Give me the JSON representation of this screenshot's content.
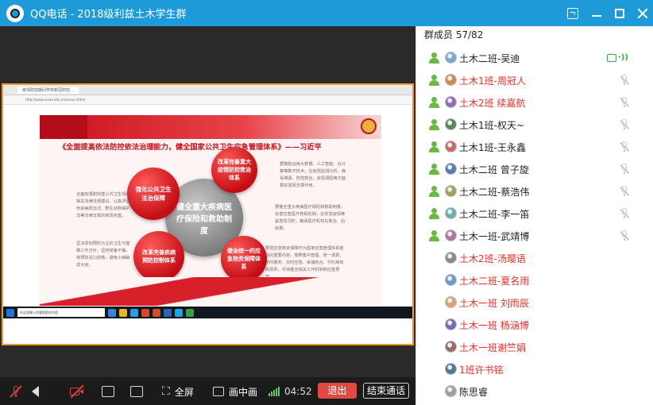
{
  "window": {
    "title": "QQ电话 - 2018级利兹土木学生群"
  },
  "shared_screen": {
    "browser_tab": "疫情防控期间学校新冠防控...",
    "address": "http://www.xxxxx.edu.cn/xxxxx.shtml",
    "slide": {
      "headline": "《全面提高依法防控依法治理能力，健全国家公共卫生应急管理体系》——习近平",
      "center_circle": "健全重大疾病医疗保险和救助制度",
      "circle_top_left": "强化公共卫生法治保障",
      "circle_top_right": "改革完善重大疫情防控救治体系",
      "circle_bottom_left": "改革完善疾病预防控制体系",
      "circle_bottom_right": "健全统一的应急物资保障体系",
      "left_text_1": "全面加强和完善公共卫生领域相关法律法规建设，认真评估传染病防治法、野生动物保护法等法律法规的修改完善。",
      "left_text_2": "坚决贯彻预防为主的卫生与健康工作方针，坚持常备不懈，将预防关口前移，避免小病酿成大疫。",
      "right_text_1": "要鼓励运用大数据、人工智能、云计算等数字技术，在疫情监测分析、病毒溯源、防控救治、资源调配等方面更好发挥支撑作用。",
      "right_text_2": "要健全重大疾病医疗保险和救助制度，完善应急医疗救助机制，在突发疫情等紧急情况时，确保医疗机构先救治、后收费。",
      "right_text_3": "要把应急物资保障作为国家应急管理体系建设的重要内容，按照集中管理、统一调拨、平时服务、灾时应急、采储结合、节约高效的原则，尽快健全相关工作机制和应急预案。"
    },
    "taskbar_search": "在这里输入你要搜索的内容"
  },
  "toolbar": {
    "fullscreen_label": "全屏",
    "pip_label": "画中画",
    "call_time": "04:52",
    "exit_label": "退出",
    "end_call_label": "结束通话"
  },
  "members_panel": {
    "header": "群成员 57/82",
    "members": [
      {
        "name": "土木二班-吴迪",
        "color": "#222222",
        "online": true,
        "speaking": true
      },
      {
        "name": "土木1班-周冠人",
        "color": "#e0312b",
        "online": true,
        "speaking": false
      },
      {
        "name": "土木2班 续嘉航",
        "color": "#e0312b",
        "online": true,
        "speaking": false
      },
      {
        "name": "土木1班-权天~",
        "color": "#222222",
        "online": true,
        "speaking": false
      },
      {
        "name": "土木1班-王永鑫",
        "color": "#222222",
        "online": true,
        "speaking": false
      },
      {
        "name": "土木二班 曾子旋",
        "color": "#222222",
        "online": true,
        "speaking": false
      },
      {
        "name": "土木二班-蔡浩伟",
        "color": "#222222",
        "online": true,
        "speaking": false
      },
      {
        "name": "土木二班-李一笛",
        "color": "#222222",
        "online": true,
        "speaking": false
      },
      {
        "name": "土木一班-武靖博",
        "color": "#222222",
        "online": true,
        "speaking": false
      },
      {
        "name": "土木2班-汤璎语",
        "color": "#e0312b",
        "online": false,
        "speaking": false
      },
      {
        "name": "土木二班-夏名雨",
        "color": "#e0312b",
        "online": false,
        "speaking": false
      },
      {
        "name": "土木一班 刘雨辰",
        "color": "#e0312b",
        "online": false,
        "speaking": false
      },
      {
        "name": "土木一班 杨涵博",
        "color": "#e0312b",
        "online": false,
        "speaking": false
      },
      {
        "name": "土木一班谢竺娟",
        "color": "#e0312b",
        "online": false,
        "speaking": false
      },
      {
        "name": "1班许书铭",
        "color": "#e0312b",
        "online": false,
        "speaking": false
      },
      {
        "name": "陈思睿",
        "color": "#222222",
        "online": false,
        "speaking": false
      }
    ]
  },
  "colors": {
    "titlebar": "#1f9ad8",
    "exit_button": "#e04a43",
    "online_icon": "#69b944",
    "slide_red": "#c8101c"
  }
}
